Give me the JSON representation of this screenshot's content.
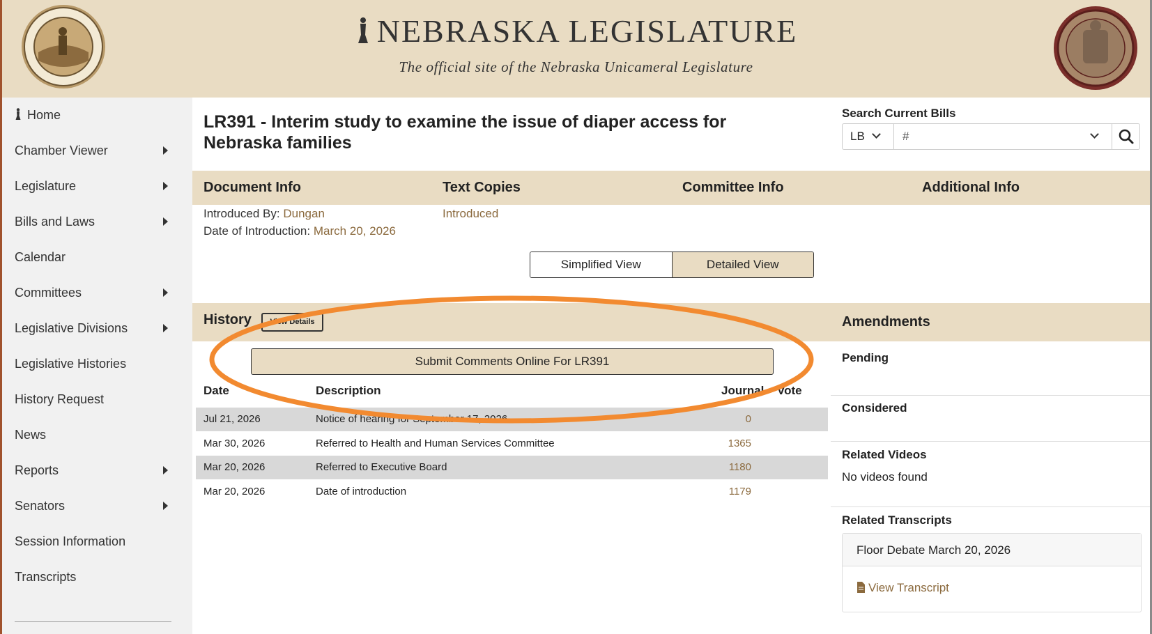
{
  "header": {
    "title": "NEBRASKA LEGISLATURE",
    "subtitle": "The official site of the Nebraska Unicameral Legislature",
    "seal_left_icon": "state-seal-icon",
    "seal_right_icon": "legislature-seal-icon"
  },
  "sidebar": {
    "items": [
      {
        "label": "Home",
        "has_submenu": false,
        "icon": "home-statue-icon"
      },
      {
        "label": "Chamber Viewer",
        "has_submenu": true
      },
      {
        "label": "Legislature",
        "has_submenu": true
      },
      {
        "label": "Bills and Laws",
        "has_submenu": true
      },
      {
        "label": "Calendar",
        "has_submenu": false
      },
      {
        "label": "Committees",
        "has_submenu": true
      },
      {
        "label": "Legislative Divisions",
        "has_submenu": true
      },
      {
        "label": "Legislative Histories",
        "has_submenu": false
      },
      {
        "label": "History Request",
        "has_submenu": false
      },
      {
        "label": "News",
        "has_submenu": false
      },
      {
        "label": "Reports",
        "has_submenu": true
      },
      {
        "label": "Senators",
        "has_submenu": true
      },
      {
        "label": "Session Information",
        "has_submenu": false
      },
      {
        "label": "Transcripts",
        "has_submenu": false
      }
    ]
  },
  "page": {
    "title": "LR391 - Interim study to examine the issue of diaper access for Nebraska families"
  },
  "search": {
    "label": "Search Current Bills",
    "type_value": "LB",
    "input_value": "#",
    "search_icon": "search-icon"
  },
  "doc_bar": {
    "headers": [
      "Document Info",
      "Text Copies",
      "Committee Info",
      "Additional Info"
    ]
  },
  "doc_info": {
    "introduced_by_label": "Introduced By:",
    "introduced_by_value": "Dungan",
    "date_label": "Date of Introduction:",
    "date_value": "March 20, 2026",
    "text_copy": "Introduced"
  },
  "views": {
    "simplified": "Simplified View",
    "detailed": "Detailed View",
    "selected": "Detailed View"
  },
  "history": {
    "title": "History",
    "view_details_label": "View Details",
    "submit_label": "Submit Comments Online For LR391",
    "columns": [
      "Date",
      "Description",
      "Journal",
      "Vote"
    ],
    "rows": [
      {
        "date": "Jul 21, 2026",
        "description": "Notice of hearing for September 17, 2026",
        "journal": "0"
      },
      {
        "date": "Mar 30, 2026",
        "description": "Referred to Health and Human Services Committee",
        "journal": "1365"
      },
      {
        "date": "Mar 20, 2026",
        "description": "Referred to Executive Board",
        "journal": "1180"
      },
      {
        "date": "Mar 20, 2026",
        "description": "Date of introduction",
        "journal": "1179"
      }
    ]
  },
  "amendments": {
    "title": "Amendments",
    "pending": "Pending",
    "considered": "Considered",
    "related_videos": "Related Videos",
    "no_videos": "No videos found",
    "related_transcripts": "Related Transcripts",
    "transcript_title": "Floor Debate March 20, 2026",
    "view_transcript": "View Transcript"
  },
  "colors": {
    "tan": "#e9dcc3",
    "link": "#8b6a3e",
    "annotation": "#f28a30",
    "row_alt": "#d8d8d8",
    "sidebar_bg": "#f1f1f1"
  }
}
